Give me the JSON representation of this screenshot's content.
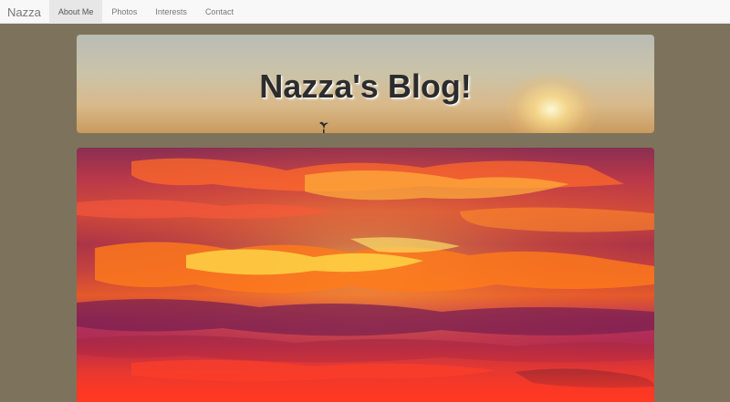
{
  "navbar": {
    "brand": "Nazza",
    "links": [
      {
        "label": "About Me",
        "active": true
      },
      {
        "label": "Photos",
        "active": false
      },
      {
        "label": "Interests",
        "active": false
      },
      {
        "label": "Contact",
        "active": false
      }
    ]
  },
  "banner": {
    "title": "Nazza's Blog!"
  },
  "colors": {
    "page_background": "#7d735c",
    "navbar_background": "#f8f8f8",
    "active_tab_background": "#e7e7e7"
  }
}
